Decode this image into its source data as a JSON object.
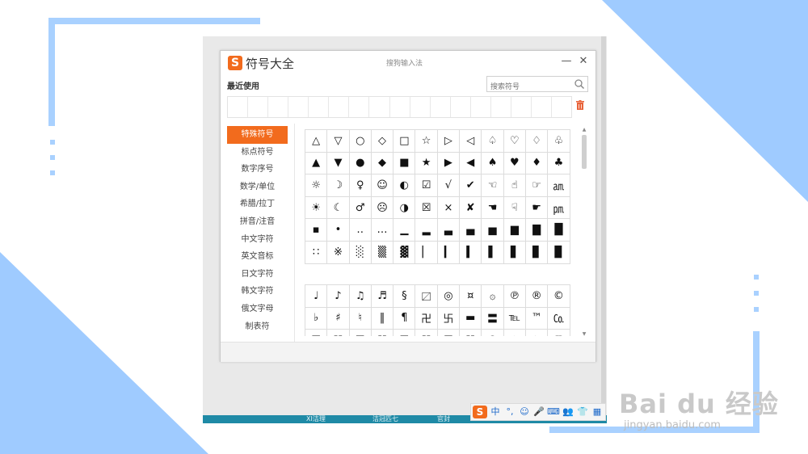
{
  "window": {
    "logo": "S",
    "title": "符号大全",
    "subtitle": "搜狗输入法",
    "minimize": "—",
    "close": "✕"
  },
  "recent": {
    "label": "最近使用"
  },
  "search": {
    "placeholder": "搜索符号"
  },
  "sidebar": {
    "items": [
      {
        "label": "特殊符号"
      },
      {
        "label": "标点符号"
      },
      {
        "label": "数字序号"
      },
      {
        "label": "数学/单位"
      },
      {
        "label": "希腊/拉丁"
      },
      {
        "label": "拼音/注音"
      },
      {
        "label": "中文字符"
      },
      {
        "label": "英文音标"
      },
      {
        "label": "日文字符"
      },
      {
        "label": "韩文字符"
      },
      {
        "label": "俄文字母"
      },
      {
        "label": "制表符"
      }
    ],
    "active_index": 0
  },
  "symbols_group1": [
    "△",
    "▽",
    "○",
    "◇",
    "□",
    "☆",
    "▷",
    "◁",
    "♤",
    "♡",
    "♢",
    "♧",
    "▲",
    "▼",
    "●",
    "◆",
    "■",
    "★",
    "▶",
    "◀",
    "♠",
    "♥",
    "♦",
    "♣",
    "☼",
    "☽",
    "♀",
    "☺",
    "◐",
    "☑",
    "√",
    "✔",
    "☜",
    "☝",
    "☞",
    "㏂",
    "☀",
    "☾",
    "♂",
    "☹",
    "◑",
    "☒",
    "×",
    "✘",
    "☚",
    "☟",
    "☛",
    "㏘",
    "▪",
    "•",
    "‥",
    "…",
    "▁",
    "▂",
    "▃",
    "▄",
    "▅",
    "▆",
    "▇",
    "█",
    "∷",
    "※",
    "░",
    "▒",
    "▓",
    "▏",
    "▎",
    "▍",
    "▌",
    "▋",
    "▊",
    "▉"
  ],
  "symbols_group2": [
    "♩",
    "♪",
    "♫",
    "♬",
    "§",
    "〼",
    "◎",
    "¤",
    "۞",
    "℗",
    "®",
    "©",
    "♭",
    "♯",
    "♮",
    "‖",
    "¶",
    "卍",
    "卐",
    "▬",
    "〓",
    "℡",
    "™",
    "㏇",
    "☰",
    "☱",
    "☲",
    "☳",
    "☴",
    "☵",
    "☶",
    "☷",
    "☯",
    "♨",
    "✈",
    "☏"
  ],
  "ime_bar": {
    "logo": "S",
    "items": [
      "中",
      "°,",
      "☺",
      "🎤",
      "⌨",
      "👥",
      "👕",
      "▦"
    ]
  },
  "taskbar": {
    "items": [
      "XI洁理",
      "洁冠匹七",
      "官封"
    ]
  },
  "watermark": {
    "text": "Bai du 经验",
    "url": "jingyan.baidu.com"
  },
  "colors": {
    "accent": "#f26b1d",
    "deco_blue": "#9fcbff",
    "taskbar": "#1f8aa6",
    "ime_icon": "#1a67c9"
  }
}
